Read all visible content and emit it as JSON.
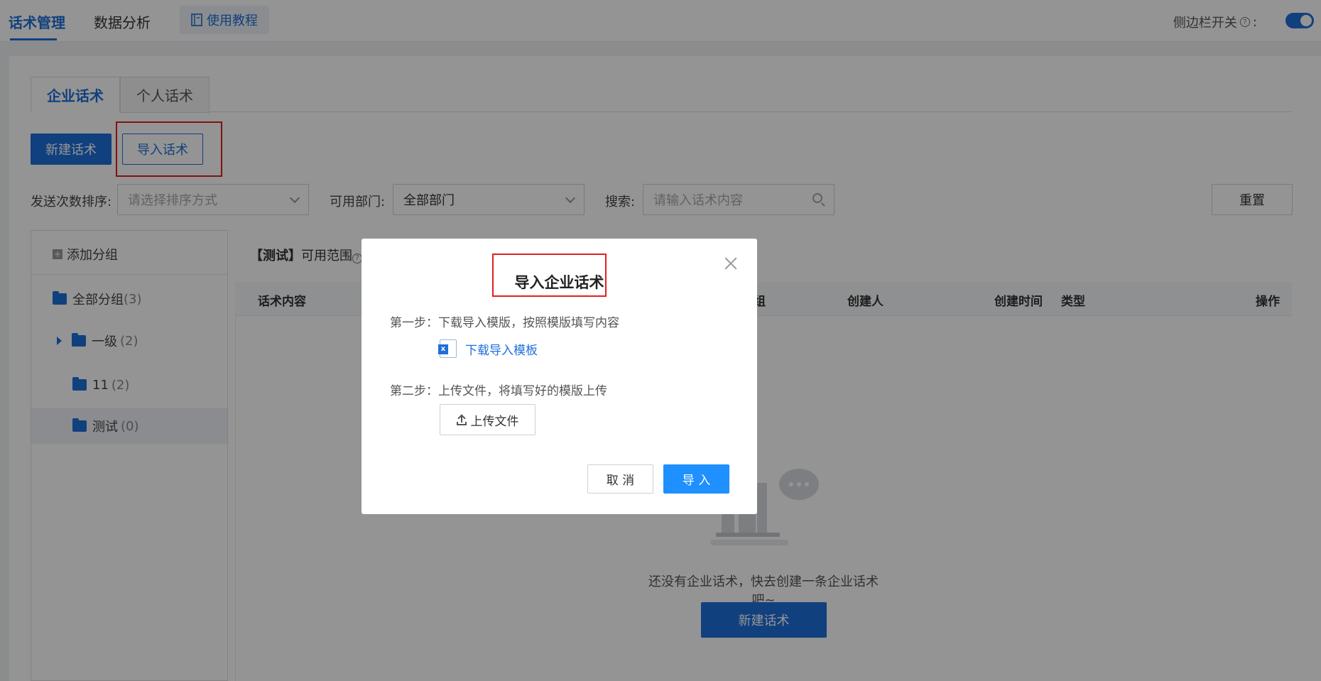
{
  "topnav": {
    "items": [
      "话术管理",
      "数据分析"
    ],
    "tutorial_label": "使用教程",
    "sidebar_toggle_label": "侧边栏开关",
    "sidebar_toggle_colon": ":"
  },
  "tabs": [
    "企业话术",
    "个人话术"
  ],
  "actions": {
    "new_label": "新建话术",
    "import_label": "导入话术"
  },
  "filters": {
    "sort_label": "发送次数排序:",
    "sort_placeholder": "请选择排序方式",
    "dept_label": "可用部门:",
    "dept_value": "全部部门",
    "search_label": "搜索:",
    "search_placeholder": "请输入话术内容",
    "reset_label": "重置"
  },
  "groups": {
    "add_label": "添加分组",
    "items": [
      {
        "name": "全部分组",
        "count": "(3)"
      },
      {
        "name": "一级",
        "count": "(2)"
      },
      {
        "name": "11",
        "count": "(2)"
      },
      {
        "name": "测试",
        "count": "(0)"
      }
    ]
  },
  "table": {
    "group_prefix": "【测试】",
    "scope_label": "可用范围",
    "columns": [
      "话术内容",
      "组",
      "创建人",
      "创建时间",
      "类型",
      "操作"
    ],
    "empty_text": "还没有企业话术，快去创建一条企业话术吧~",
    "empty_new_label": "新建话术"
  },
  "modal": {
    "title": "导入企业话术",
    "step1": "第一步：下载导入模版，按照模版填写内容",
    "download_label": "下载导入模板",
    "step2": "第二步：上传文件，将填写好的模版上传",
    "upload_label": "上传文件",
    "cancel_label": "取 消",
    "import_label": "导 入"
  },
  "colors": {
    "accent": "#1e6fd9",
    "primary_button": "#1e90ff",
    "highlight_box": "#e02020"
  }
}
